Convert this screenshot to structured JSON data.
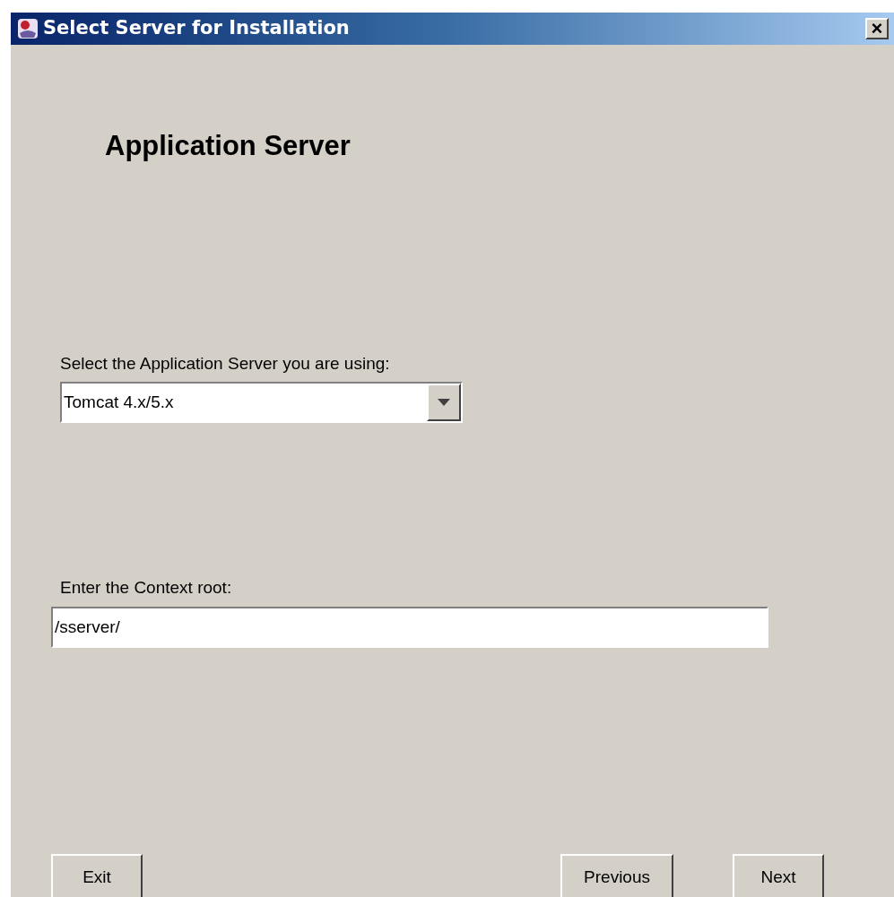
{
  "window": {
    "title": "Select Server for Installation",
    "close": "×"
  },
  "heading": "Application Server",
  "server": {
    "label": "Select the Application Server you are using:",
    "value": "Tomcat 4.x/5.x"
  },
  "context_root": {
    "label": "Enter the Context root:",
    "value": "/sserver/"
  },
  "left_buttons": [
    "Exit"
  ],
  "right_buttons": [
    "Previous",
    "Next"
  ]
}
